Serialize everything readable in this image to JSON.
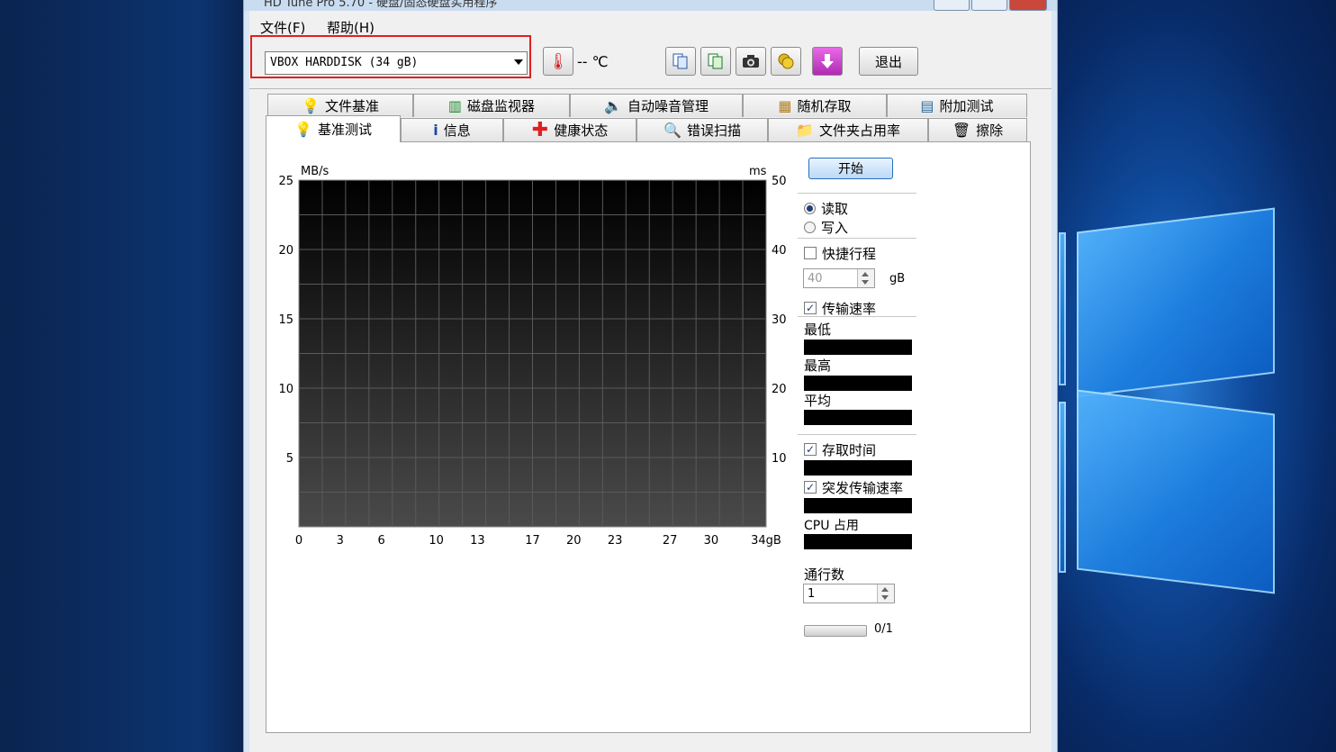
{
  "window": {
    "title": "HD Tune Pro 5.70 - 硬盘/固态硬盘实用程序"
  },
  "menu": {
    "file": "文件(F)",
    "help": "帮助(H)"
  },
  "toolbar": {
    "drive": "VBOX HARDDISK (34 gB)",
    "temperature": "-- ℃",
    "exit_label": "退出"
  },
  "tabs_top": [
    "文件基准",
    "磁盘监视器",
    "自动噪音管理",
    "随机存取",
    "附加测试"
  ],
  "tabs_bottom": [
    "基准测试",
    "信息",
    "健康状态",
    "错误扫描",
    "文件夹占用率",
    "擦除"
  ],
  "controls": {
    "start": "开始",
    "read": "读取",
    "write": "写入",
    "short_stroke": "快捷行程",
    "short_stroke_value": "40",
    "short_stroke_unit": "gB",
    "transfer_rate": "传输速率",
    "min": "最低",
    "max": "最高",
    "avg": "平均",
    "access_time": "存取时间",
    "burst_rate": "突发传输速率",
    "cpu_usage": "CPU 占用",
    "passes_label": "通行数",
    "passes_value": "1",
    "progress_text": "0/1",
    "progress": 0
  },
  "chart_data": {
    "type": "line",
    "left_unit": "MB/s",
    "right_unit": "ms",
    "y_left_ticks": [
      "25",
      "20",
      "15",
      "10",
      "5"
    ],
    "y_right_ticks": [
      "50",
      "40",
      "30",
      "20",
      "10"
    ],
    "x_ticks": [
      "0",
      "3",
      "6",
      "10",
      "13",
      "17",
      "20",
      "23",
      "27",
      "30",
      "34gB"
    ],
    "ylim_left": [
      0,
      25
    ],
    "ylim_right": [
      0,
      50
    ],
    "xlim": [
      0,
      34
    ],
    "grid": true,
    "series": []
  }
}
